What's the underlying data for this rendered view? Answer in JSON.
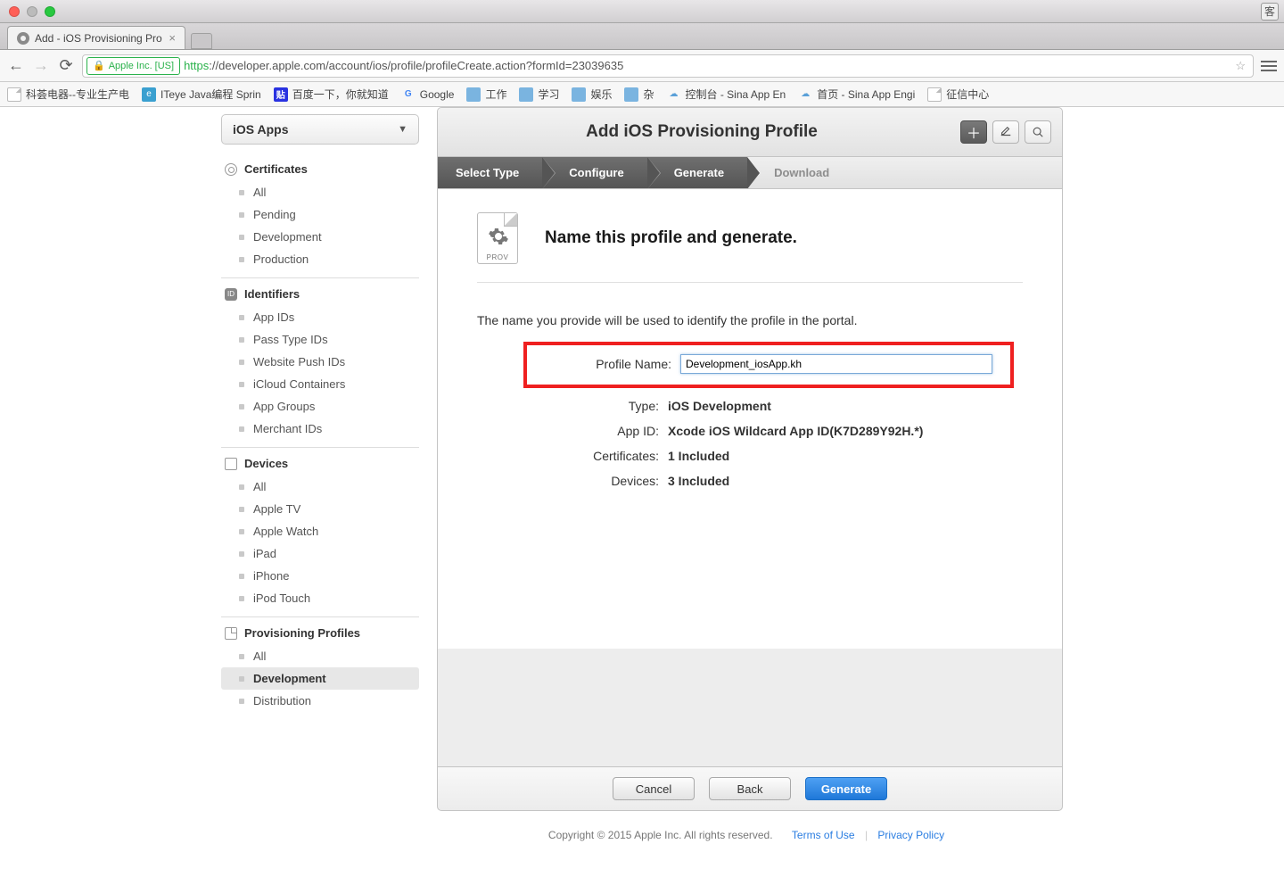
{
  "browser": {
    "tab_title": "Add - iOS Provisioning Pro",
    "url_identity": "Apple Inc. [US]",
    "url_scheme": "https",
    "url_rest": "://developer.apple.com/account/ios/profile/profileCreate.action?formId=23039635"
  },
  "bookmarks": [
    {
      "label": "科荟电器--专业生产电",
      "icon": "page"
    },
    {
      "label": "ITeye Java编程 Sprin",
      "icon": "iteye"
    },
    {
      "label": "百度一下，你就知道",
      "icon": "baidu"
    },
    {
      "label": "Google",
      "icon": "google"
    },
    {
      "label": "工作",
      "icon": "folder"
    },
    {
      "label": "学习",
      "icon": "folder"
    },
    {
      "label": "娱乐",
      "icon": "folder"
    },
    {
      "label": "杂",
      "icon": "folder"
    },
    {
      "label": "控制台 - Sina App En",
      "icon": "cloud"
    },
    {
      "label": "首页 - Sina App Engi",
      "icon": "cloud"
    },
    {
      "label": "征信中心",
      "icon": "page"
    }
  ],
  "sidebar": {
    "dropdown": "iOS Apps",
    "sections": [
      {
        "title": "Certificates",
        "icon": "cert",
        "items": [
          "All",
          "Pending",
          "Development",
          "Production"
        ]
      },
      {
        "title": "Identifiers",
        "icon": "id",
        "items": [
          "App IDs",
          "Pass Type IDs",
          "Website Push IDs",
          "iCloud Containers",
          "App Groups",
          "Merchant IDs"
        ]
      },
      {
        "title": "Devices",
        "icon": "dev",
        "items": [
          "All",
          "Apple TV",
          "Apple Watch",
          "iPad",
          "iPhone",
          "iPod Touch"
        ]
      },
      {
        "title": "Provisioning Profiles",
        "icon": "prov",
        "items": [
          "All",
          "Development",
          "Distribution"
        ],
        "active": "Development"
      }
    ]
  },
  "panel": {
    "title": "Add iOS Provisioning Profile",
    "steps": [
      "Select Type",
      "Configure",
      "Generate",
      "Download"
    ],
    "active_step_index": 2,
    "intro_heading": "Name this profile and generate.",
    "prov_label": "PROV",
    "hint": "The name you provide will be used to identify the profile in the portal.",
    "fields": {
      "profile_name_label": "Profile Name:",
      "profile_name_value": "Development_iosApp.kh",
      "type_label": "Type:",
      "type_value": "iOS Development",
      "appid_label": "App ID:",
      "appid_value": "Xcode iOS Wildcard App ID(K7D289Y92H.*)",
      "certs_label": "Certificates:",
      "certs_value": "1 Included",
      "devices_label": "Devices:",
      "devices_value": "3 Included"
    },
    "buttons": {
      "cancel": "Cancel",
      "back": "Back",
      "generate": "Generate"
    }
  },
  "legal": {
    "copyright": "Copyright © 2015 Apple Inc. All rights reserved.",
    "terms": "Terms of Use",
    "privacy": "Privacy Policy"
  }
}
